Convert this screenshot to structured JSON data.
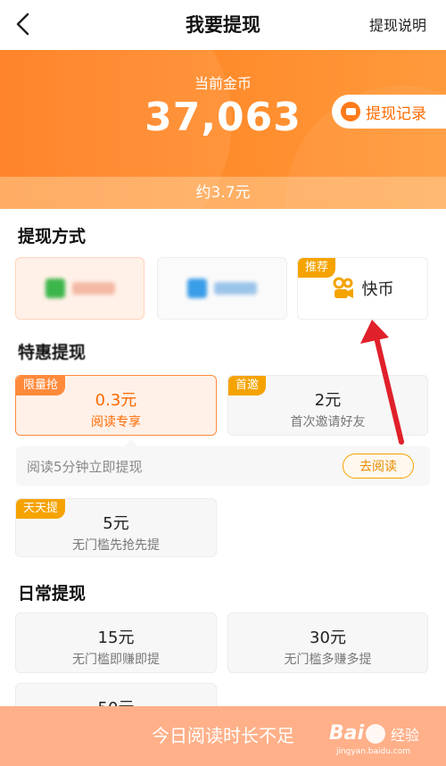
{
  "nav": {
    "title": "我要提现",
    "help": "提现说明"
  },
  "balance": {
    "label": "当前金币",
    "value": "37,063",
    "approx": "约3.7元",
    "record_label": "提现记录"
  },
  "methods": {
    "title": "提现方式",
    "items": [
      {
        "label": "微信",
        "selected": true
      },
      {
        "label": "支付宝",
        "selected": false
      },
      {
        "label": "快币",
        "tag": "推荐",
        "selected": false
      }
    ]
  },
  "special": {
    "title": "特惠提现",
    "items": [
      {
        "tag": "限量抢",
        "amount": "0.3元",
        "desc": "阅读专享",
        "active": true
      },
      {
        "tag": "首邀",
        "amount": "2元",
        "desc": "首次邀请好友",
        "active": false
      },
      {
        "tag": "天天提",
        "amount": "5元",
        "desc": "无门槛先抢先提",
        "active": false
      }
    ],
    "hint": {
      "text": "阅读5分钟立即提现",
      "button": "去阅读"
    }
  },
  "daily": {
    "title": "日常提现",
    "items": [
      {
        "amount": "15元",
        "desc": "无门槛即赚即提"
      },
      {
        "amount": "30元",
        "desc": "无门槛多赚多提"
      },
      {
        "amount": "50元",
        "desc": ""
      }
    ]
  },
  "bottom": {
    "label": "今日阅读时长不足",
    "watermark_brand": "Bai",
    "watermark_text": "经验",
    "watermark_url": "jingyan.baidu.com"
  },
  "colors": {
    "accent": "#ff7a1a",
    "tag": "#f5a300",
    "arrow": "#e0202a"
  }
}
